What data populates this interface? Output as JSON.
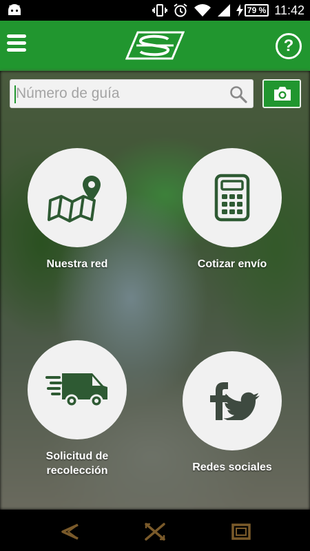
{
  "status_bar": {
    "battery_percent": "79 %",
    "time": "11:42"
  },
  "search": {
    "placeholder": "Número de guía",
    "value": ""
  },
  "tiles": [
    {
      "label": "Nuestra red",
      "icon": "map-pin-icon"
    },
    {
      "label": "Cotizar envío",
      "icon": "calculator-icon"
    },
    {
      "label": "Solicitud de recolección",
      "icon": "delivery-truck-icon"
    },
    {
      "label": "Redes sociales",
      "icon": "social-media-icon"
    }
  ],
  "help_label": "?",
  "colors": {
    "primary": "#21962f",
    "icon": "#2e5a33",
    "tile_bg": "#f1f1f1",
    "nav_button": "#7a5a2a"
  }
}
